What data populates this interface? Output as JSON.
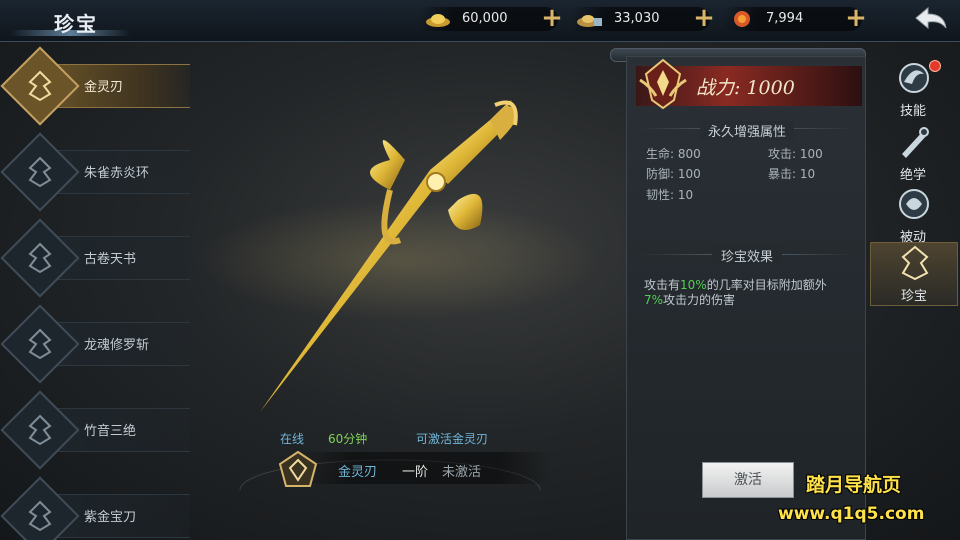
{
  "header": {
    "title": "珍宝",
    "resources": [
      {
        "icon": "gold-ingot-icon",
        "value": "60,000"
      },
      {
        "icon": "silver-ingot-icon",
        "value": "33,030"
      },
      {
        "icon": "coupon-icon",
        "value": "7,994"
      }
    ]
  },
  "treasure_list": [
    {
      "label": "金灵刃",
      "active": true
    },
    {
      "label": "朱雀赤炎环",
      "active": false
    },
    {
      "label": "古卷天书",
      "active": false
    },
    {
      "label": "龙魂修罗斩",
      "active": false
    },
    {
      "label": "竹音三绝",
      "active": false
    },
    {
      "label": "紫金宝刀",
      "active": false
    }
  ],
  "unlock": {
    "condition": "在线",
    "duration": "60分钟",
    "result": "可激活金灵刃"
  },
  "selected": {
    "name": "金灵刃",
    "level": "一阶",
    "status": "未激活"
  },
  "panel": {
    "power_label": "战力: 1000",
    "attributes_title": "永久增强属性",
    "stats": [
      {
        "label": "生命: 800"
      },
      {
        "label": "攻击: 100"
      },
      {
        "label": "防御: 100"
      },
      {
        "label": "暴击: 10"
      },
      {
        "label": "韧性: 10"
      }
    ],
    "effect_title": "珍宝效果",
    "effect_pre": "攻击有",
    "effect_pct1": "10%",
    "effect_mid": "的几率对目标附加额外",
    "effect_pct2": "7%",
    "effect_post": "攻击力的伤害",
    "activate_button": "激活"
  },
  "tabs": [
    {
      "label": "技能",
      "icon": "skill-icon",
      "badge": true
    },
    {
      "label": "绝学",
      "icon": "ultimate-icon",
      "badge": false
    },
    {
      "label": "被动",
      "icon": "passive-icon",
      "badge": false
    },
    {
      "label": "珍宝",
      "icon": "treasure-icon",
      "badge": false,
      "active": true
    }
  ],
  "watermark": {
    "line1": "踏月导航页",
    "line2": "www.q1q5.com"
  },
  "colors": {
    "accent_gold": "#c4a060",
    "power_red": "#8a2a22",
    "highlight_green": "#4fd04f",
    "link_blue": "#6fb5d8"
  }
}
